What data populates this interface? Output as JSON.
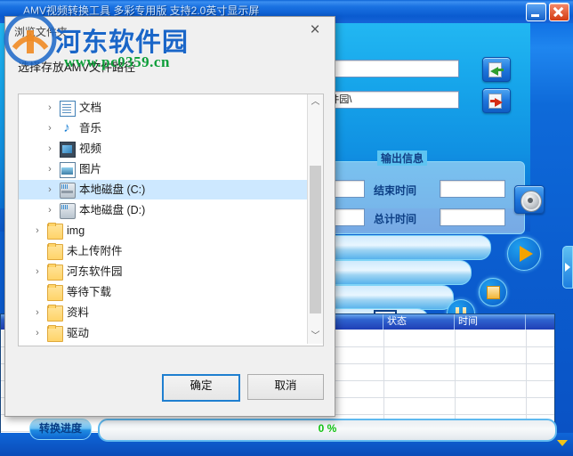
{
  "main_window": {
    "title": "AMV视频转换工具 多彩专用版 支持2.0英寸显示屏",
    "minimize_label": "最小化",
    "close_label": "关闭",
    "source_path_value": "",
    "source_path_placeholder": "",
    "output_path_value": "tools\\桌面\\河东软件园\\",
    "import_button_label": "导入",
    "export_button_label": "导出",
    "settings_button_label": "设置",
    "help_button_label": "?",
    "output_group": {
      "title": "输出信息",
      "end_time_label": "结束时间",
      "end_time_value": "",
      "total_time_label": "总计时间",
      "total_time_value": "",
      "start_value": "",
      "elapsed_value": ""
    },
    "media_controls": {
      "play_label": "播放",
      "stop_label": "停止",
      "pause_label": "暂停"
    },
    "grid": {
      "columns": [
        "",
        "状态",
        "时间",
        ""
      ],
      "rows": [
        [
          "",
          "",
          "",
          ""
        ],
        [
          "",
          "",
          "",
          ""
        ],
        [
          "",
          "",
          "",
          ""
        ],
        [
          "",
          "",
          "",
          ""
        ],
        [
          "",
          "",
          "",
          ""
        ]
      ]
    },
    "status": {
      "progress_label": "转换进度",
      "progress_text": "0 %",
      "progress_percent": 0
    },
    "side_tab_label": "展开"
  },
  "watermark": {
    "site_name": "河东软件园",
    "url": "www.pc0359.cn"
  },
  "dialog": {
    "title": "浏览文件夹",
    "close_label": "×",
    "prompt": "选择存放AMV文件路径",
    "tree": [
      {
        "label": "文档",
        "icon": "document-icon",
        "indent": 2,
        "expandable": true,
        "selected": false
      },
      {
        "label": "音乐",
        "icon": "music-icon",
        "indent": 2,
        "expandable": true,
        "selected": false
      },
      {
        "label": "视频",
        "icon": "video-icon",
        "indent": 2,
        "expandable": true,
        "selected": false
      },
      {
        "label": "图片",
        "icon": "picture-icon",
        "indent": 2,
        "expandable": true,
        "selected": false
      },
      {
        "label": "本地磁盘 (C:)",
        "icon": "system-disk-icon",
        "indent": 2,
        "expandable": true,
        "selected": true
      },
      {
        "label": "本地磁盘 (D:)",
        "icon": "disk-icon",
        "indent": 2,
        "expandable": true,
        "selected": false
      },
      {
        "label": "img",
        "icon": "folder-icon",
        "indent": 1,
        "expandable": true,
        "selected": false
      },
      {
        "label": "未上传附件",
        "icon": "folder-icon",
        "indent": 1,
        "expandable": false,
        "selected": false
      },
      {
        "label": "河东软件园",
        "icon": "folder-icon",
        "indent": 1,
        "expandable": true,
        "selected": false
      },
      {
        "label": "等待下载",
        "icon": "folder-icon",
        "indent": 1,
        "expandable": false,
        "selected": false
      },
      {
        "label": "资料",
        "icon": "folder-icon",
        "indent": 1,
        "expandable": true,
        "selected": false
      },
      {
        "label": "驱动",
        "icon": "folder-icon",
        "indent": 1,
        "expandable": true,
        "selected": false
      }
    ],
    "ok_label": "确定",
    "cancel_label": "取消",
    "scrollbar": {
      "up_label": "︿",
      "down_label": "﹀"
    }
  },
  "colors": {
    "window_blue": "#0a4fc4",
    "panel_cyan": "#16a4ea",
    "accent_orange": "#f5a300",
    "progress_green": "#12c312",
    "watermark_blue": "#1a66c8",
    "watermark_green": "#0e9e3a",
    "selection_blue": "#cde8ff"
  }
}
